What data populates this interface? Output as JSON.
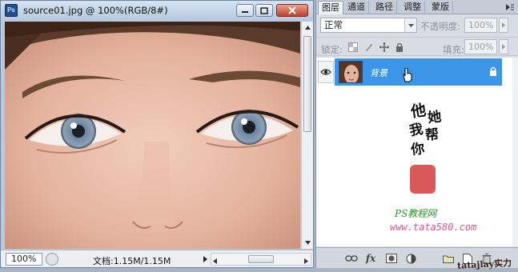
{
  "document": {
    "title": "source01.jpg @ 100%(RGB/8#)",
    "zoom": "100%",
    "doc_info": "文档:1.15M/1.15M"
  },
  "panel": {
    "tabs": [
      "图层",
      "通道",
      "路径",
      "调整",
      "蒙版"
    ],
    "blend_mode": "正常",
    "opacity_label": "不透明度:",
    "opacity_value": "100%",
    "lock_label": "锁定:",
    "fill_label": "填充:",
    "fill_value": "100%",
    "layer": {
      "name": "背景",
      "visible": true,
      "locked": true,
      "selected": true
    }
  },
  "watermark": {
    "text_cols": [
      "他",
      "她",
      "我",
      "帮",
      "你"
    ],
    "site_name": "PS教程网",
    "site_url": "www.tata580.com",
    "corner_text": "tatajlay实力"
  },
  "colors": {
    "selection_blue": "#3d95e8",
    "seal_red": "#d23b3b",
    "site_green": "#2d9a2d",
    "site_pink": "#e0529a"
  },
  "icons": [
    "photoshop-icon",
    "minimize-icon",
    "maximize-icon",
    "close-icon",
    "eye-icon",
    "lock-icon",
    "cursor-hand-icon",
    "link-icon",
    "fx-icon",
    "mask-icon",
    "adjustment-icon",
    "folder-icon",
    "new-layer-icon",
    "trash-icon"
  ]
}
